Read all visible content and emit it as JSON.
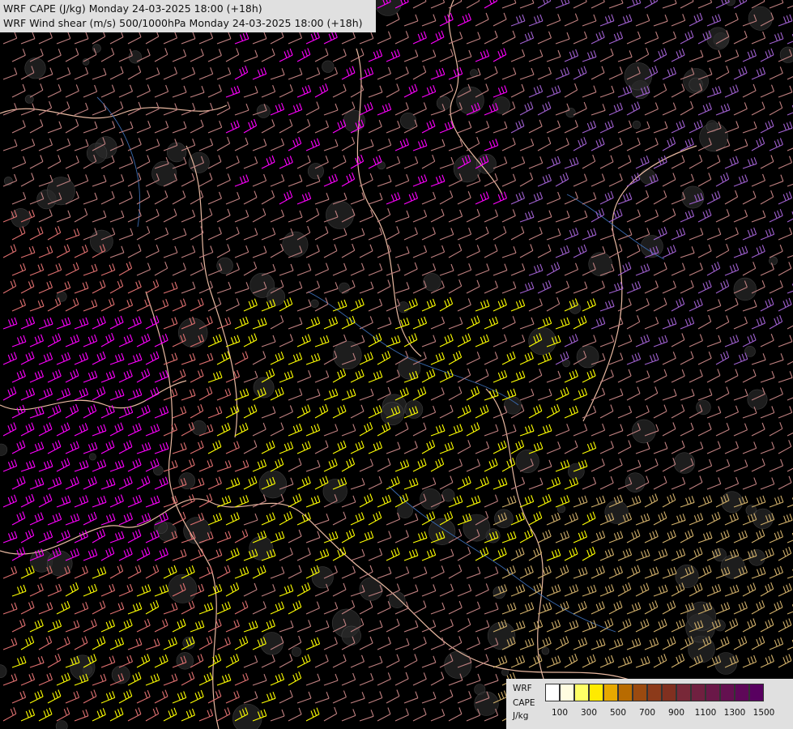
{
  "header": {
    "title_line1": "WRF CAPE (J/kg) Monday 24-03-2025 18:00 (+18h)",
    "title_line2": "WRF Wind shear (m/s) 500/1000hPa Monday 24-03-2025 18:00 (+18h)"
  },
  "legend": {
    "label_model": "WRF",
    "label_param": "CAPE",
    "label_unit": "J/kg",
    "colors": [
      "#ffffff",
      "#fffde0",
      "#ffff66",
      "#ffea00",
      "#e6a800",
      "#b86b00",
      "#9a4a10",
      "#8c3a1a",
      "#803020",
      "#782838",
      "#702040",
      "#6a1848",
      "#641050",
      "#5e0858",
      "#580060"
    ],
    "tick_labels": [
      "100",
      "300",
      "500",
      "700",
      "900",
      "1100",
      "1300",
      "1500"
    ]
  },
  "map": {
    "background": "#000000",
    "barb_colors": {
      "low": "#c08080",
      "mid": "#e07070",
      "strong": "#ffff00",
      "stronger": "#d2b06a",
      "max": "#ff00ff",
      "violet": "#a060d0"
    }
  }
}
